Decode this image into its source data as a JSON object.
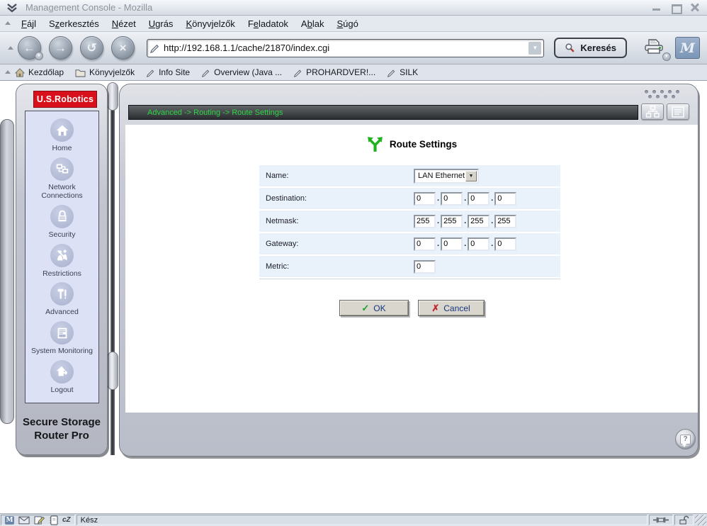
{
  "window": {
    "title": "Management Console - Mozilla"
  },
  "menubar": {
    "items": [
      {
        "pre": "",
        "u": "F",
        "post": "ájl"
      },
      {
        "pre": "S",
        "u": "z",
        "post": "erkesztés"
      },
      {
        "pre": "",
        "u": "N",
        "post": "ézet"
      },
      {
        "pre": "",
        "u": "U",
        "post": "grás"
      },
      {
        "pre": "",
        "u": "K",
        "post": "önyvjelzők"
      },
      {
        "pre": "F",
        "u": "e",
        "post": "ladatok"
      },
      {
        "pre": "A",
        "u": "b",
        "post": "lak"
      },
      {
        "pre": "",
        "u": "S",
        "post": "úgó"
      }
    ]
  },
  "toolbar": {
    "url": "http://192.168.1.1/cache/21870/index.cgi",
    "search_label": "Keresés",
    "mozilla_logo_text": "M",
    "icons": {
      "back": "←",
      "forward": "→",
      "reload": "↺",
      "stop": "×",
      "dropdown": "▼"
    }
  },
  "bookmarks_bar": {
    "items": [
      "Kezdőlap",
      "Könyvjelzők",
      "Info Site",
      "Overview (Java ...",
      "PROHARDVER!...",
      "SILK"
    ]
  },
  "router": {
    "brand": "U.S.Robotics",
    "device_name_line1": "Secure Storage",
    "device_name_line2": "Router Pro",
    "breadcrumb": "Advanced -> Routing -> Route Settings",
    "sidebar": {
      "items": [
        {
          "label": "Home"
        },
        {
          "label": "Network Connections"
        },
        {
          "label": "Security"
        },
        {
          "label": "Restrictions"
        },
        {
          "label": "Advanced"
        },
        {
          "label": "System Monitoring"
        },
        {
          "label": "Logout"
        }
      ]
    },
    "page": {
      "title": "Route Settings",
      "form": {
        "octet_sep": ".",
        "name": {
          "label": "Name:",
          "value": "LAN Ethernet"
        },
        "destination": {
          "label": "Destination:",
          "octets": [
            "0",
            "0",
            "0",
            "0"
          ]
        },
        "netmask": {
          "label": "Netmask:",
          "octets": [
            "255",
            "255",
            "255",
            "255"
          ]
        },
        "gateway": {
          "label": "Gateway:",
          "octets": [
            "0",
            "0",
            "0",
            "0"
          ]
        },
        "metric": {
          "label": "Metric:",
          "value": "0"
        }
      },
      "buttons": {
        "ok": "OK",
        "cancel": "Cancel",
        "ok_glyph": "✓",
        "cancel_glyph": "✗"
      },
      "help_glyph": "?"
    },
    "colors": {
      "brand_red": "#d8101c",
      "breadcrumb_green": "#2fd546",
      "row_blue": "#e9f1fa"
    }
  },
  "statusbar": {
    "status": "Kész",
    "composer_label": "cZ"
  }
}
